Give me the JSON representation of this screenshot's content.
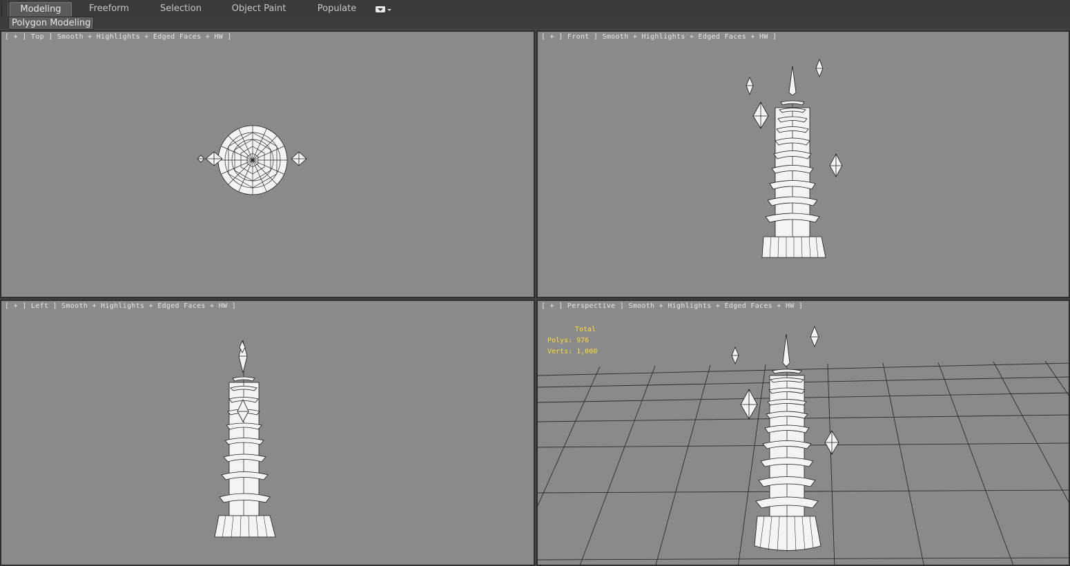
{
  "ribbon": {
    "tabs": [
      {
        "label": "Modeling",
        "active": true
      },
      {
        "label": "Freeform",
        "active": false
      },
      {
        "label": "Selection",
        "active": false
      },
      {
        "label": "Object Paint",
        "active": false
      },
      {
        "label": "Populate",
        "active": false
      }
    ],
    "panel_label": "Polygon Modeling",
    "overflow_icon": "dropdown-arrow-icon"
  },
  "viewports": {
    "top": {
      "label": "[ + ] Top ] Smooth + Highlights + Edged Faces + HW ]"
    },
    "front": {
      "label": "[ + ] Front ] Smooth + Highlights + Edged Faces + HW ]"
    },
    "left": {
      "label": "[ + ] Left ] Smooth + Highlights + Edged Faces + HW ]"
    },
    "perspective": {
      "label": "[ + ] Perspective ] Smooth + Highlights + Edged Faces + HW ]"
    }
  },
  "stats": {
    "title": "Total",
    "polys": "Polys: 976",
    "verts": "Verts: 1,000"
  },
  "colors": {
    "viewport_bg": "#8a8a8a",
    "stats_text": "#ffdf3c",
    "ui_dark": "#3a3a3a"
  }
}
